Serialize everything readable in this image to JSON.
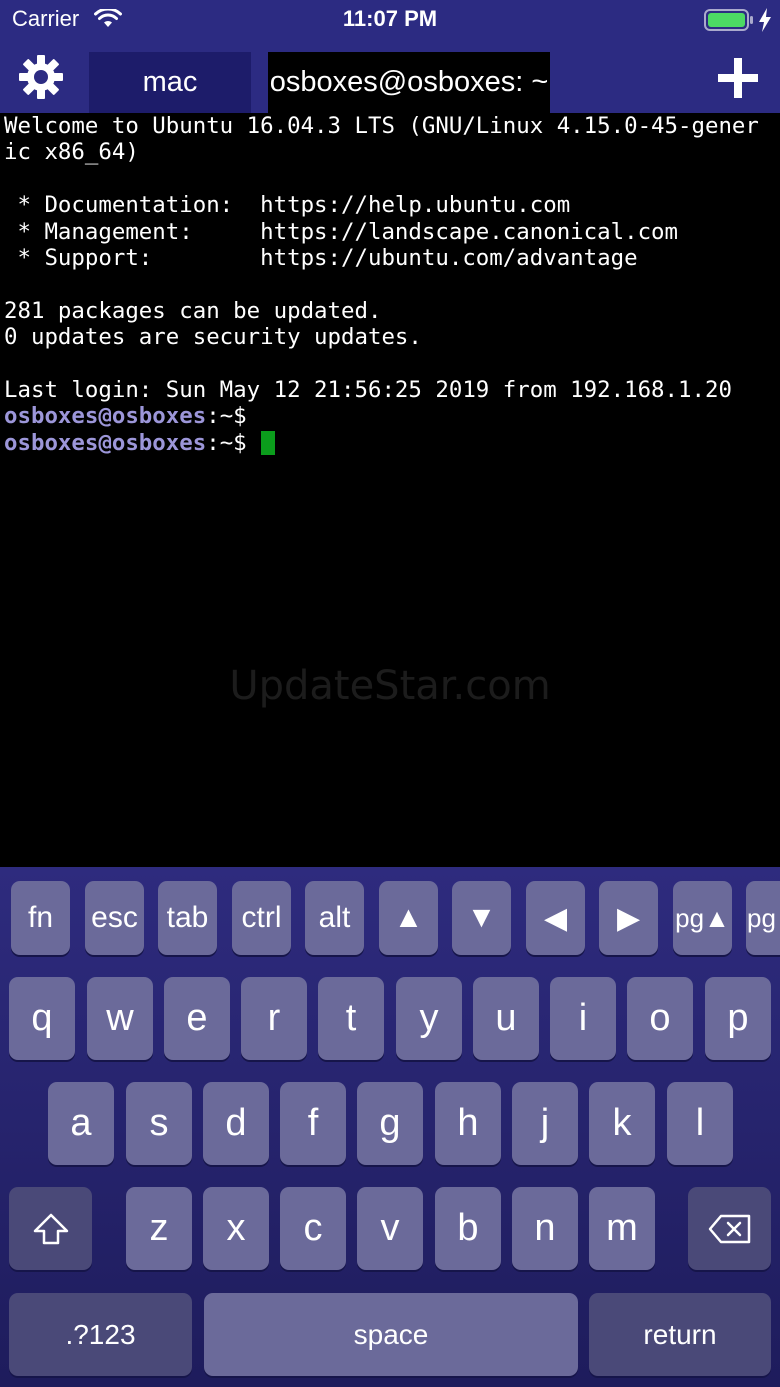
{
  "status_bar": {
    "carrier": "Carrier",
    "time": "11:07 PM",
    "icons": [
      "wifi-icon",
      "battery-icon",
      "charging-bolt-icon"
    ],
    "battery_color": "#4cd964"
  },
  "tab_bar": {
    "settings_icon": "gear-icon",
    "tabs": [
      {
        "label": "mac",
        "active": false
      },
      {
        "label": "osboxes@osboxes: ~",
        "active": true
      }
    ],
    "add_icon": "plus-icon"
  },
  "terminal": {
    "lines": [
      "Welcome to Ubuntu 16.04.3 LTS (GNU/Linux 4.15.0-45-gener",
      "ic x86_64)",
      "",
      " * Documentation:  https://help.ubuntu.com",
      " * Management:     https://landscape.canonical.com",
      " * Support:        https://ubuntu.com/advantage",
      "",
      "281 packages can be updated.",
      "0 updates are security updates.",
      "",
      "Last login: Sun May 12 21:56:25 2019 from 192.168.1.20"
    ],
    "prompt_user": "osboxes@osboxes",
    "prompt_suffix": ":~$",
    "cursor_color": "#0b9d1c",
    "watermark": "UpdateStar.com"
  },
  "keyboard": {
    "function_row": [
      "fn",
      "esc",
      "tab",
      "ctrl",
      "alt",
      "▲",
      "▼",
      "◀",
      "▶",
      "pg▲",
      "pg▼"
    ],
    "row1": [
      "q",
      "w",
      "e",
      "r",
      "t",
      "y",
      "u",
      "i",
      "o",
      "p"
    ],
    "row2": [
      "a",
      "s",
      "d",
      "f",
      "g",
      "h",
      "j",
      "k",
      "l"
    ],
    "row3": [
      "z",
      "x",
      "c",
      "v",
      "b",
      "n",
      "m"
    ],
    "shift_icon": "shift-arrow-icon",
    "delete_icon": "backspace-icon",
    "numbers_label": ".?123",
    "space_label": "space",
    "return_label": "return"
  }
}
